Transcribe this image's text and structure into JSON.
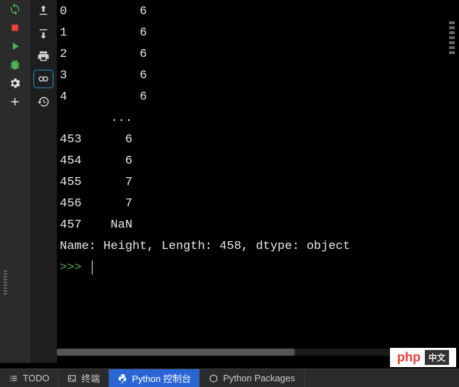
{
  "console": {
    "rows_top": [
      {
        "index": "0",
        "value": "6"
      },
      {
        "index": "1",
        "value": "6"
      },
      {
        "index": "2",
        "value": "6"
      },
      {
        "index": "3",
        "value": "6"
      },
      {
        "index": "4",
        "value": "6"
      }
    ],
    "ellipsis": "       ...",
    "rows_bottom": [
      {
        "index": "453",
        "value": "6"
      },
      {
        "index": "454",
        "value": "6"
      },
      {
        "index": "455",
        "value": "7"
      },
      {
        "index": "456",
        "value": "7"
      },
      {
        "index": "457",
        "value": "NaN"
      }
    ],
    "summary": "Name: Height, Length: 458, dtype: object",
    "prompt": ">>> "
  },
  "tabs": {
    "todo": "TODO",
    "terminal": "终端",
    "python_console": "Python 控制台",
    "python_packages": "Python Packages"
  },
  "watermark": {
    "php": "php",
    "cn": "中文"
  }
}
